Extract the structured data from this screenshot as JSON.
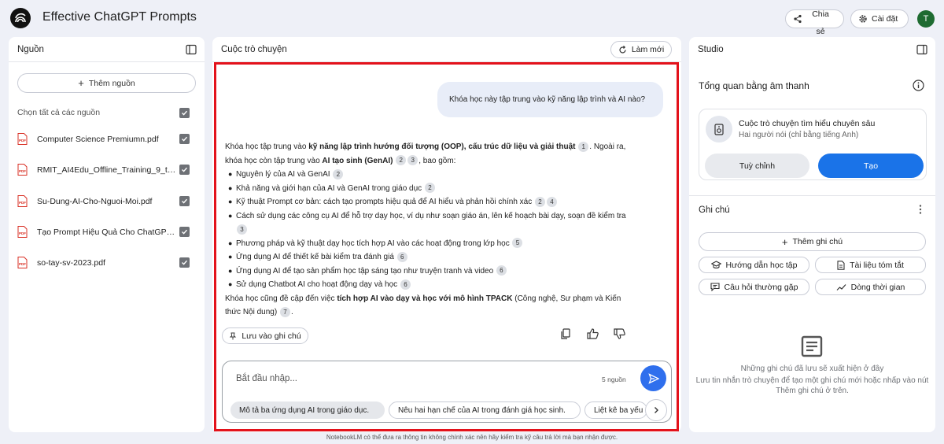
{
  "header": {
    "title": "Effective ChatGPT Prompts",
    "share_label": "Chia sẻ",
    "settings_label": "Cài đặt",
    "avatar_initial": "T"
  },
  "sources": {
    "title": "Nguồn",
    "add_label": "Thêm nguồn",
    "select_all_label": "Chọn tất cả các nguồn",
    "items": [
      "Computer Science Premiumn.pdf",
      "RMIT_AI4Edu_Offline_Training_9_th_...",
      "Su-Dung-AI-Cho-Nguoi-Moi.pdf",
      "Tạo Prompt Hiệu Quả Cho ChatGPT....",
      "so-tay-sv-2023.pdf"
    ]
  },
  "chat": {
    "title": "Cuộc trò chuyện",
    "new_label": "Làm mới",
    "user_question": "Khóa học này tập trung vào kỹ năng lập trình và AI nào?",
    "intro_1": "Khóa học tập trung vào ",
    "intro_bold_1": "kỹ năng lập trình hướng đối tượng (OOP), cấu trúc dữ liệu và giải thuật",
    "intro_2": ". Ngoài ra, khóa học còn tập trung vào ",
    "intro_bold_2": "AI tạo sinh (GenAI)",
    "intro_3": ", bao gồm:",
    "bullets": [
      "Nguyên lý của AI và GenAI",
      "Khả năng và giới hạn của AI và GenAI trong giáo dục",
      "Kỹ thuật Prompt cơ bản: cách tạo prompts hiệu quả để AI hiểu và phản hồi chính xác",
      "Cách sử dụng các công cụ AI để hỗ trợ dạy học, ví dụ như soạn giáo án, lên kế hoạch bài dạy, soạn đề kiểm tra",
      "Phương pháp và kỹ thuật dạy học tích hợp AI vào các hoạt động trong lớp học",
      "Ứng dụng AI để thiết kế bài kiểm tra đánh giá",
      "Ứng dụng AI để tạo sản phẩm học tập sáng tạo như truyện tranh và video",
      "Sử dụng Chatbot AI cho hoạt động dạy và học"
    ],
    "outro_1": "Khóa học cũng đề cập đến việc ",
    "outro_bold": "tích hợp AI vào dạy và học với mô hình TPACK",
    "outro_2": " (Công nghệ, Sư phạm và Kiến thức Nội dung)",
    "save_note_label": "Lưu vào ghi chú",
    "input_placeholder": "Bắt đầu nhập...",
    "source_count": "5 nguồn",
    "suggestions": [
      "Mô tả ba ứng dụng AI trong giáo dục.",
      "Nêu hai hạn chế của AI trong đánh giá học sinh.",
      "Liệt kê ba yếu"
    ]
  },
  "studio": {
    "title": "Studio",
    "audio_title": "Tổng quan bằng âm thanh",
    "card_title": "Cuộc trò chuyện tìm hiểu chuyên sâu",
    "card_sub": "Hai người nói (chỉ bằng tiếng Anh)",
    "customize_label": "Tuỳ chỉnh",
    "create_label": "Tạo",
    "notes_title": "Ghi chú",
    "add_note_label": "Thêm ghi chú",
    "study_guide_label": "Hướng dẫn học tập",
    "summary_label": "Tài liệu tóm tắt",
    "faq_label": "Câu hỏi thường gặp",
    "timeline_label": "Dòng thời gian",
    "empty_1": "Những ghi chú đã lưu sẽ xuất hiện ở đây",
    "empty_2": "Lưu tin nhắn trò chuyện để tạo một ghi chú mới hoặc nhấp vào nút Thêm ghi chú ở trên."
  },
  "footer": "NotebookLM có thể đưa ra thông tin không chính xác nên hãy kiểm tra kỹ câu trả lời mà bạn nhận được.",
  "colors": {
    "accent": "#1a73e8",
    "highlight_frame": "#e3121b"
  }
}
